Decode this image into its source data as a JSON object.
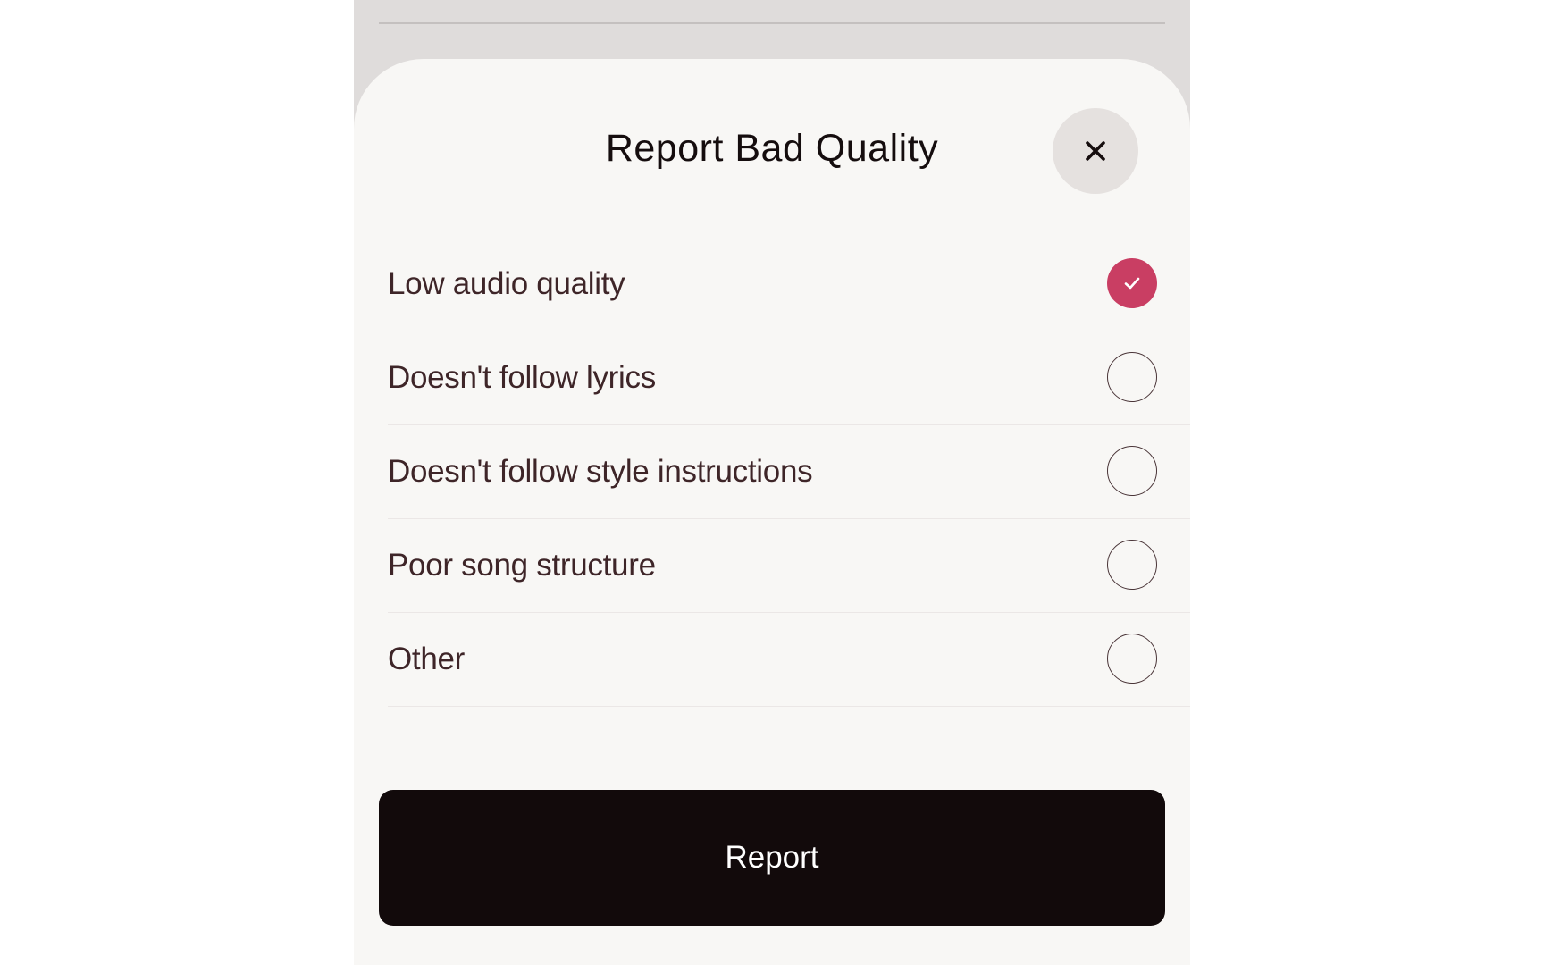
{
  "modal": {
    "title": "Report Bad Quality",
    "close_icon": "close-icon",
    "options": [
      {
        "label": "Low audio quality",
        "checked": true
      },
      {
        "label": "Doesn't follow lyrics",
        "checked": false
      },
      {
        "label": "Doesn't follow style instructions",
        "checked": false
      },
      {
        "label": "Poor song structure",
        "checked": false
      },
      {
        "label": "Other",
        "checked": false
      }
    ],
    "submit_label": "Report"
  },
  "colors": {
    "accent": "#c93e63",
    "button_bg": "#120a0b",
    "sheet_bg": "#f8f7f5",
    "backdrop": "#dfdcdb"
  }
}
